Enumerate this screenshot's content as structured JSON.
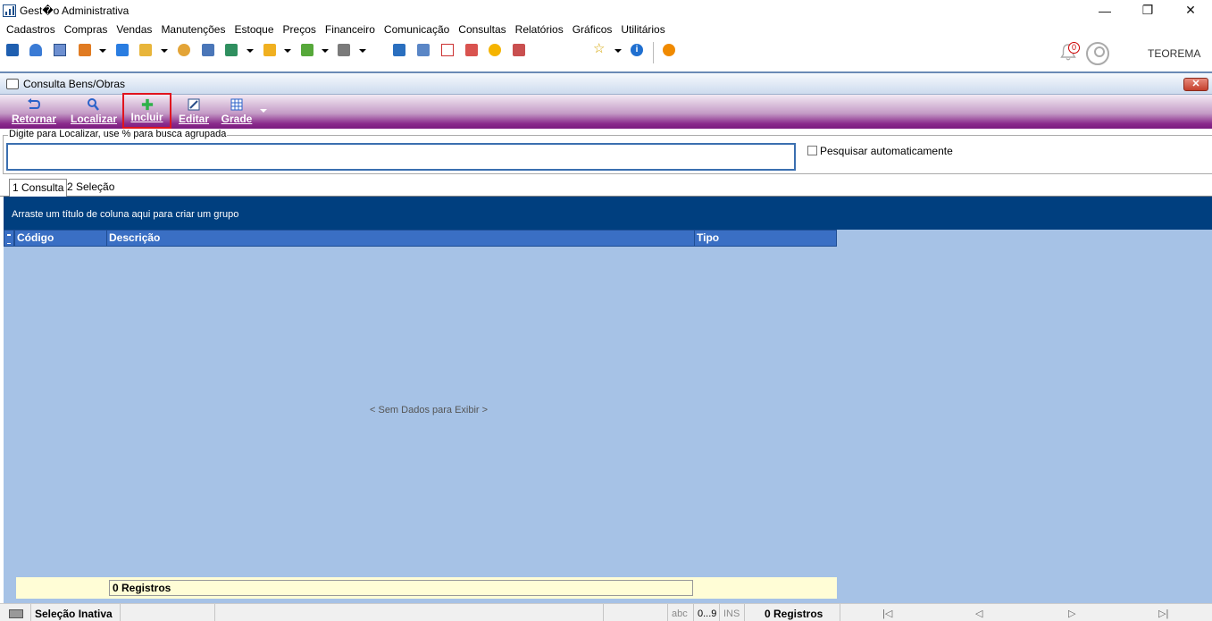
{
  "window": {
    "title": "Gest�o Administrativa",
    "minimize": "—",
    "restore": "❐",
    "close": "✕"
  },
  "menu": [
    "Cadastros",
    "Compras",
    "Vendas",
    "Manutenções",
    "Estoque",
    "Preços",
    "Financeiro",
    "Comunicação",
    "Consultas",
    "Relatórios",
    "Gráficos",
    "Utilitários"
  ],
  "header_right": {
    "notifications_count": "0",
    "company": "TEOREMA"
  },
  "inner_window": {
    "title": "Consulta Bens/Obras",
    "close": "✕"
  },
  "actions": {
    "retornar": "Retornar",
    "localizar": "Localizar",
    "incluir": "Incluir",
    "editar": "Editar",
    "grade": "Grade"
  },
  "search": {
    "legend": "Digite para Localizar, use % para busca agrupada",
    "value": "",
    "auto_label": "Pesquisar automaticamente"
  },
  "tabs": {
    "consulta": "1 Consulta",
    "selecao": "2 Seleção"
  },
  "grid": {
    "group_hint": "Arraste um título de coluna aqui para criar um grupo",
    "columns": [
      "Código",
      "Descrição",
      "Tipo"
    ],
    "empty_text": "< Sem Dados para Exibir >",
    "footer_count": "0 Registros"
  },
  "status": {
    "selection": "Seleção Inativa",
    "abc": "abc",
    "digits": "0...9",
    "ins": "INS",
    "records": "0 Registros",
    "nav_first": "|◁",
    "nav_prev": "◁",
    "nav_next": "▷",
    "nav_last": "▷|"
  },
  "colors": {
    "group_panel": "#003f7f",
    "grid_bg": "#a6c2e6",
    "header": "#3a6fc4",
    "action_bar": "#7a1a7e",
    "highlight": "#e0141e"
  }
}
